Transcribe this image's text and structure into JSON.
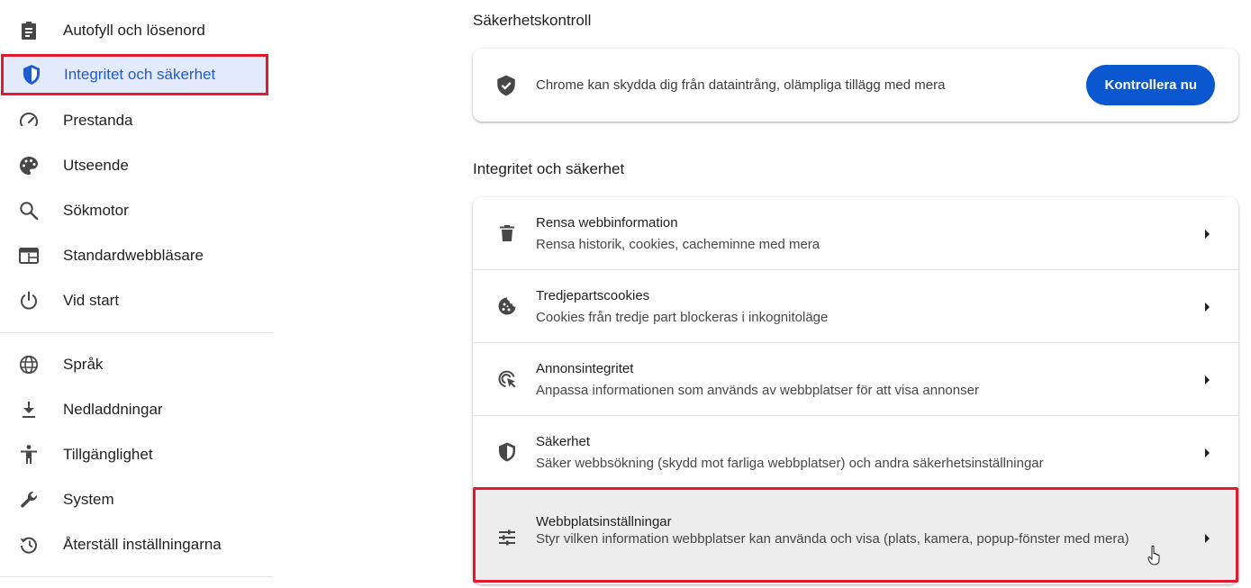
{
  "sidebar": {
    "items": [
      {
        "label": "Autofyll och lösenord",
        "icon": "clipboard-icon"
      },
      {
        "label": "Integritet och säkerhet",
        "icon": "shield-icon",
        "active": true
      },
      {
        "label": "Prestanda",
        "icon": "speedometer-icon"
      },
      {
        "label": "Utseende",
        "icon": "palette-icon"
      },
      {
        "label": "Sökmotor",
        "icon": "search-icon"
      },
      {
        "label": "Standardwebbläsare",
        "icon": "browser-icon"
      },
      {
        "label": "Vid start",
        "icon": "power-icon"
      },
      {
        "label": "Språk",
        "icon": "globe-icon"
      },
      {
        "label": "Nedladdningar",
        "icon": "download-icon"
      },
      {
        "label": "Tillgänglighet",
        "icon": "accessibility-icon"
      },
      {
        "label": "System",
        "icon": "wrench-icon"
      },
      {
        "label": "Återställ inställningarna",
        "icon": "reset-icon"
      }
    ]
  },
  "safety_check": {
    "section_title": "Säkerhetskontroll",
    "description": "Chrome kan skydda dig från dataintrång, olämpliga tillägg med mera",
    "button_label": "Kontrollera nu"
  },
  "privacy": {
    "section_title": "Integritet och säkerhet",
    "rows": [
      {
        "title": "Rensa webbinformation",
        "subtitle": "Rensa historik, cookies, cacheminne med mera",
        "icon": "trash-icon"
      },
      {
        "title": "Tredjepartscookies",
        "subtitle": "Cookies från tredje part blockeras i inkognitoläge",
        "icon": "cookie-icon"
      },
      {
        "title": "Annonsintegritet",
        "subtitle": "Anpassa informationen som används av webbplatser för att visa annonser",
        "icon": "ad-privacy-icon"
      },
      {
        "title": "Säkerhet",
        "subtitle": "Säker webbsökning (skydd mot farliga webbplatser) och andra säkerhetsinställningar",
        "icon": "security-shield-icon"
      },
      {
        "title": "Webbplatsinställningar",
        "subtitle": "Styr vilken information webbplatser kan använda och visa (plats, kamera, popup-fönster med mera)",
        "icon": "sliders-icon"
      }
    ]
  },
  "colors": {
    "accent": "#0b57d0",
    "active_bg": "#e3eafb",
    "highlight_border": "#e3192d"
  }
}
